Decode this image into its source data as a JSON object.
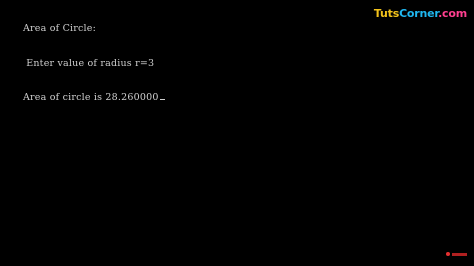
{
  "console": {
    "lines": [
      "Area of Circle:",
      " Enter value of radius r=3",
      "Area of circle is 28.260000"
    ]
  },
  "brand": {
    "tuts": "Tuts",
    "corner": "Corner",
    "com": ".com"
  },
  "colors": {
    "background": "#000000",
    "text": "#cfcfcf",
    "brand_tuts": "#f2c21b",
    "brand_corner": "#1fb7f0",
    "brand_com": "#ff3f8f"
  }
}
